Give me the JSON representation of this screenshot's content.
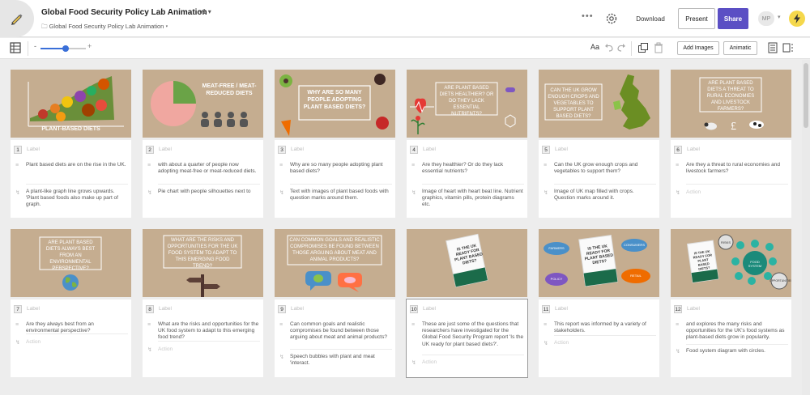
{
  "header": {
    "title": "Global Food Security Policy Lab Animation",
    "version": "v1",
    "project": "Global Food Security Policy Lab Animation",
    "download": "Download",
    "present": "Present",
    "share": "Share",
    "avatar": "MP",
    "more": "•••"
  },
  "toolbar": {
    "zoom_level": 0.55,
    "font_label": "Aa",
    "add_images": "Add Images",
    "animatic": "Animatic"
  },
  "colors": {
    "accent": "#5b4fc4",
    "frame_bg": "#c5ad90",
    "zoom_blue": "#3a6fd8"
  },
  "frames": [
    {
      "num": "1",
      "label": "Label",
      "image_text": "PLANT-BASED DIETS",
      "desc1": "Plant based diets are on the rise in the UK.",
      "desc2": "A plant-like graph line grows upwards. 'Plant based foods also make up part of graph."
    },
    {
      "num": "2",
      "label": "Label",
      "image_text": "MEAT-FREE / MEAT-REDUCED DIETS",
      "desc1": "with about a quarter of people now adopting meat-free or meat-reduced diets.",
      "desc2": "Pie chart with people silhouettes next to"
    },
    {
      "num": "3",
      "label": "Label",
      "image_text": "WHY ARE SO MANY PEOPLE ADOPTING PLANT BASED DIETS?",
      "desc1": "Why are so many people adopting plant based diets?",
      "desc2": "Text with images of plant based foods with question marks around them."
    },
    {
      "num": "4",
      "label": "Label",
      "image_text": "ARE PLANT BASED DIETS HEALTHIER? OR DO THEY LACK ESSENTIAL NUTRIENTS?",
      "desc1": "Are they healthier? Or do they lack essential nutrients?",
      "desc2": "Image of heart with heart beat line. Nutrient graphics, vitamin pills, protein diagrams etc."
    },
    {
      "num": "5",
      "label": "Label",
      "image_text": "CAN THE UK GROW ENOUGH CROPS AND VEGETABLES TO SUPPORT PLANT BASED DIETS?",
      "desc1": "Can the UK grow enough crops and vegetables to support them?",
      "desc2": "Image of UK map filled with crops. Question marks around it."
    },
    {
      "num": "6",
      "label": "Label",
      "image_text": "ARE PLANT BASED DIETS A THREAT TO RURAL ECONOMIES AND LIVESTOCK FARMERS?",
      "desc1": "Are they a threat to rural economies and livestock farmers?",
      "desc2": "",
      "action": "Action"
    },
    {
      "num": "7",
      "label": "Label",
      "image_text": "ARE PLANT BASED DIETS ALWAYS BEST FROM AN ENVIRONMENTAL PERSPECTIVE?",
      "desc1": "Are they always best from an environmental perspective?",
      "desc2": "",
      "action": "Action"
    },
    {
      "num": "8",
      "label": "Label",
      "image_text": "WHAT ARE THE RISKS AND OPPORTUNITIES FOR THE UK FOOD SYSTEM TO ADAPT TO THIS EMERGING FOOD TREND?",
      "desc1": "What are the risks and opportunities for the UK food system to adapt to this emerging food trend?",
      "desc2": "",
      "action": "Action"
    },
    {
      "num": "9",
      "label": "Label",
      "image_text": "CAN COMMON GOALS AND REALISTIC COMPROMISES BE FOUND BETWEEN THOSE ARGUING ABOUT MEAT AND ANIMAL PRODUCTS?",
      "desc1": "Can common goals and realistic compromises be found between those arguing about meat and animal products?",
      "desc2": "Speech bubbles with plant and meat 'interact."
    },
    {
      "num": "10",
      "label": "Label",
      "image_text": "IS THE UK READY FOR PLANT BASED DIETS?",
      "desc1": "These are just some of the questions that researchers have investigated for the Global Food Security Program report 'Is the UK ready for plant based diets?'.",
      "desc2": "",
      "action": "Action"
    },
    {
      "num": "11",
      "label": "Label",
      "image_text": "IS THE UK READY FOR PLANT BASED DIETS?",
      "bubbles": [
        "FARMERS",
        "CONSUMERS",
        "POLICY",
        "RETAIL"
      ],
      "desc1": "This report was informed by a variety of stakeholders.",
      "desc2": "",
      "action": "Action"
    },
    {
      "num": "12",
      "label": "Label",
      "image_text": "IS THE UK READY FOR PLANT BASED DIETS?",
      "bubbles": [
        "RISKS",
        "FOOD SYSTEM",
        "OPPORTUNITIES"
      ],
      "desc1": "and explores the many risks and opportunities for the UK's food systems as plant-based diets grow in popularity.",
      "desc2": "Food system diagram with circles."
    }
  ]
}
